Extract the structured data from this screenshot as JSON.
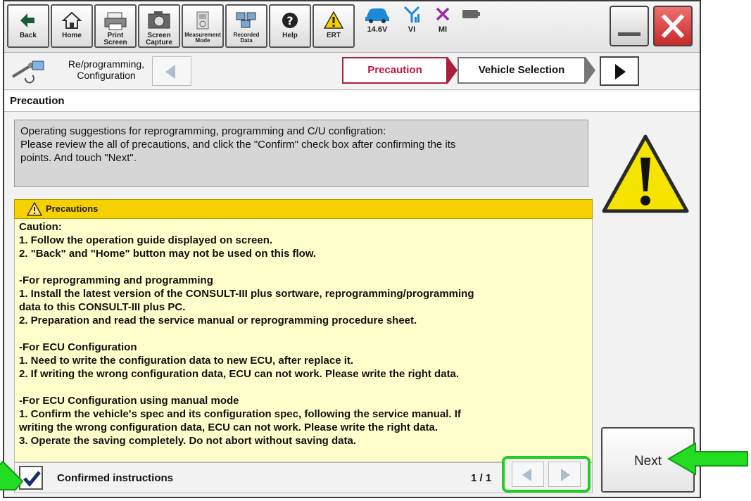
{
  "toolbar": {
    "buttons": [
      {
        "label": "Back"
      },
      {
        "label": "Home"
      },
      {
        "label": "Print Screen"
      },
      {
        "label": "Screen Capture"
      },
      {
        "label": "Measurement Mode"
      },
      {
        "label": "Recorded Data"
      },
      {
        "label": "Help"
      },
      {
        "label": "ERT"
      }
    ],
    "voltage": "14.6V",
    "vi": "VI",
    "mi": "MI"
  },
  "nav": {
    "section": "Re/programming, Configuration",
    "steps": [
      "Precaution",
      "Vehicle Selection"
    ]
  },
  "header": {
    "title": "Precaution"
  },
  "intro": {
    "lines": [
      "Operating suggestions for reprogramming, programming and C/U configration:",
      "Please review the all of precautions, and click the \"Confirm\" check box after confirming the its",
      "points. And touch \"Next\"."
    ]
  },
  "precautions": {
    "title": "Precautions",
    "lines": [
      "Caution:",
      "1. Follow the operation guide displayed on screen.",
      "2. \"Back\" and \"Home\" button may not be used on this flow.",
      "",
      "-For reprogramming and programming",
      "1. Install the latest version of the CONSULT-III plus sortware, reprogramming/programming",
      "data to this CONSULT-III plus PC.",
      "2. Preparation and read the service manual or reprogramming procedure sheet.",
      "",
      "-For ECU Configuration",
      "1. Need to write the configuration data to new ECU, after replace it.",
      "2. If writing the wrong configuration data, ECU can not work. Please write the right data.",
      "",
      "-For ECU Configuration using manual mode",
      "1. Confirm the vehicle's spec and its configuration spec, following the service manual.  If",
      "writing the wrong configuration data, ECU can not work. Please write the right data.",
      "3. Operate the saving completely. Do not abort without saving data."
    ]
  },
  "footer": {
    "confirm_label": "Confirmed instructions",
    "confirmed": true,
    "page": "1 / 1"
  },
  "next_button": {
    "label": "Next"
  },
  "colors": {
    "highlight_green": "#22cc22",
    "arrow_green": "#22dd22",
    "precaution_yellow": "#f7d000",
    "precaution_body": "#ffffcc",
    "close_red": "#e04040"
  }
}
